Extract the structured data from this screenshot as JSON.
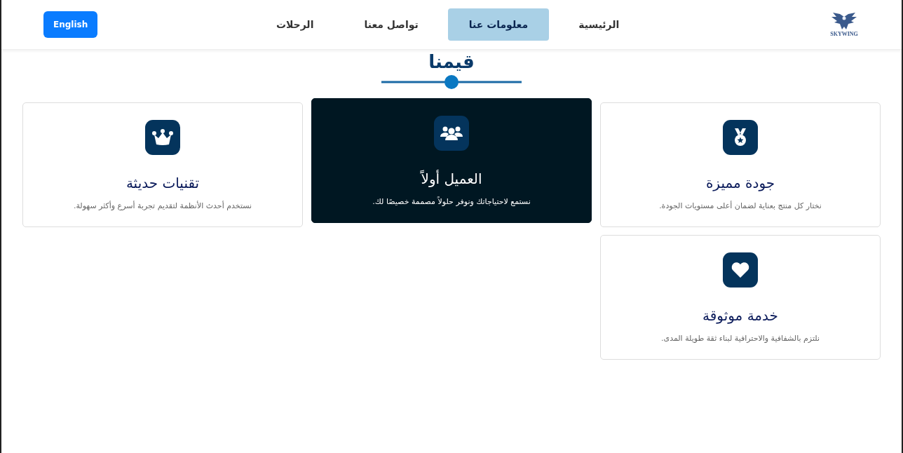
{
  "header": {
    "logo_text": "SKYWING",
    "nav": [
      {
        "label": "الرئيسية",
        "selected": false
      },
      {
        "label": "معلومات عنا",
        "selected": true
      },
      {
        "label": "تواصل معنا",
        "selected": false
      },
      {
        "label": "الرحلات",
        "selected": false
      }
    ],
    "language_button": "English"
  },
  "section": {
    "title": "قيمنا"
  },
  "cards": [
    {
      "title": "جودة مميزة",
      "text": "نختار كل منتج بعناية لضمان أعلى مستويات الجودة.",
      "highlighted": false
    },
    {
      "title": "العميل أولاً",
      "text": "نستمع لاحتياجاتك ونوفر حلولاً مصممة خصيصًا لك.",
      "highlighted": true
    },
    {
      "title": "تقنيات حديثة",
      "text": "نستخدم أحدث الأنظمة لتقديم تجربة أسرع وأكثر سهولة.",
      "highlighted": false
    },
    {
      "title": "خدمة موثوقة",
      "text": "نلتزم بالشفافية والاحترافية لبناء ثقة طويلة المدى.",
      "highlighted": false
    }
  ]
}
